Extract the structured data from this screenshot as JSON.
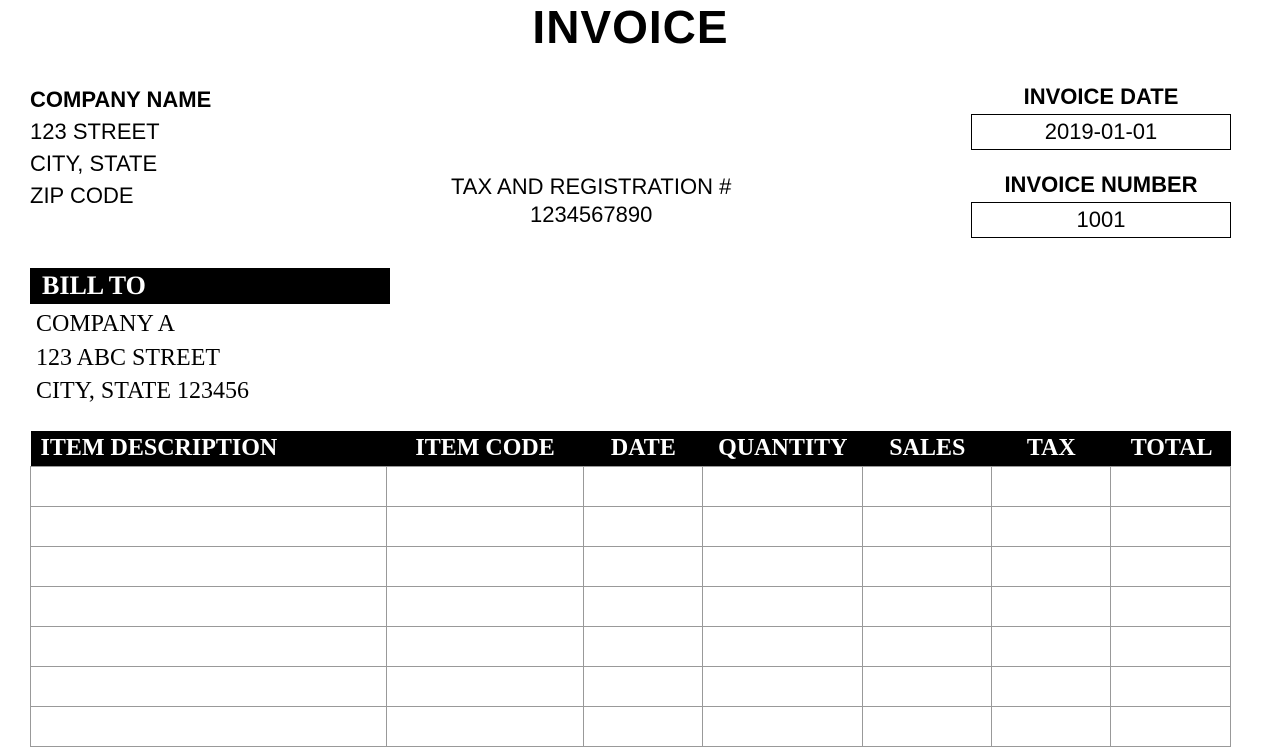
{
  "title": "INVOICE",
  "company": {
    "name_label": "COMPANY NAME",
    "street": "123 STREET",
    "city_state": "CITY, STATE",
    "zip": "ZIP CODE"
  },
  "tax_reg": {
    "label": "TAX AND REGISTRATION #",
    "value": "1234567890"
  },
  "invoice_date": {
    "label": "INVOICE DATE",
    "value": "2019-01-01"
  },
  "invoice_number": {
    "label": "INVOICE NUMBER",
    "value": "1001"
  },
  "bill_to": {
    "header": "BILL TO",
    "company": "COMPANY A",
    "street": "123 ABC STREET",
    "city_state_zip": "CITY, STATE 123456"
  },
  "table": {
    "headers": {
      "desc": "ITEM DESCRIPTION",
      "code": "ITEM CODE",
      "date": "DATE",
      "qty": "QUANTITY",
      "sales": "SALES",
      "tax": "TAX",
      "total": "TOTAL"
    }
  }
}
